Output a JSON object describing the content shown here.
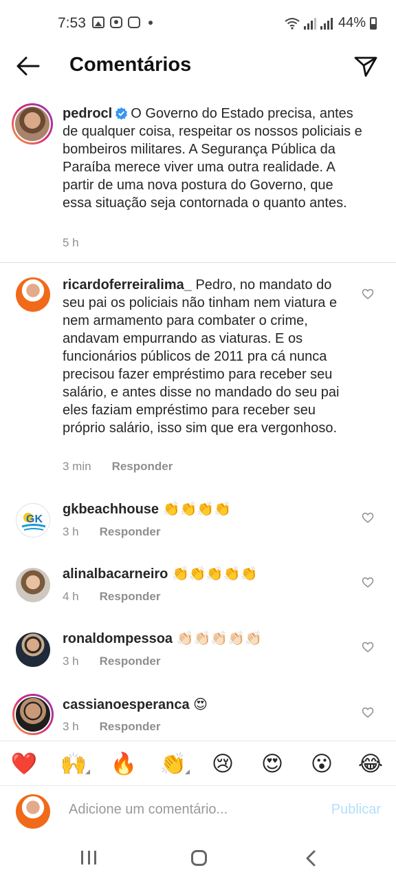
{
  "status_bar": {
    "time": "7:53",
    "battery": "44%"
  },
  "header": {
    "title": "Comentários"
  },
  "post": {
    "username": "pedrocl",
    "text": "O Governo do Estado precisa, antes de qualquer coisa, respeitar os nossos policiais e bombeiros militares. A Segurança Pública da Paraíba merece viver uma outra realidade. A partir de uma nova postura do Governo, que essa situação seja contornada o quanto antes.",
    "time": "5 h"
  },
  "comments": [
    {
      "username": "ricardoferreiralima_",
      "text": "Pedro, no mandato do seu pai os policiais não tinham nem viatura e nem armamento para combater o crime, andavam empurrando as viaturas. E os funcionários públicos de 2011 pra cá nunca precisou fazer empréstimo para receber seu salário, e antes disse no mandado do seu pai eles faziam empréstimo para receber seu próprio salário, isso sim que era vergonhoso.",
      "time": "3 min",
      "reply_label": "Responder"
    },
    {
      "username": "gkbeachhouse",
      "text": "👏👏👏👏",
      "time": "3 h",
      "reply_label": "Responder"
    },
    {
      "username": "alinalbacarneiro",
      "text": "👏👏👏👏👏",
      "time": "4 h",
      "reply_label": "Responder"
    },
    {
      "username": "ronaldompessoa",
      "text": "👏🏻👏🏻👏🏻👏🏻👏🏻",
      "time": "3 h",
      "reply_label": "Responder"
    },
    {
      "username": "cassianoesperanca",
      "text": "😍",
      "time": "3 h",
      "reply_label": "Responder"
    }
  ],
  "emoji_bar": [
    "❤️",
    "🙌",
    "🔥",
    "👏",
    "😢",
    "😍",
    "😮",
    "😂"
  ],
  "composer": {
    "placeholder": "Adicione um comentário...",
    "publish_label": "Publicar"
  },
  "colors": {
    "accent": "#0095f6",
    "publish_disabled": "#b2dffc",
    "muted": "#8e8e8e"
  }
}
